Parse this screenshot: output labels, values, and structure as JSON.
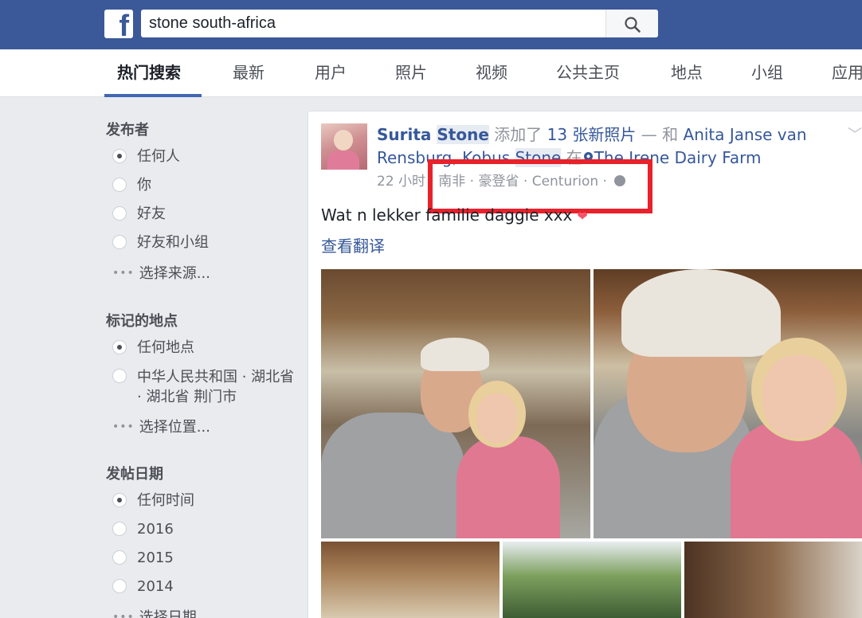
{
  "topbar": {
    "logo": "f",
    "search_value": "stone south-africa",
    "search_icon": "search-icon"
  },
  "tabs": [
    {
      "label": "热门搜索",
      "active": true
    },
    {
      "label": "最新"
    },
    {
      "label": "用户"
    },
    {
      "label": "照片"
    },
    {
      "label": "视频"
    },
    {
      "label": "公共主页"
    },
    {
      "label": "地点"
    },
    {
      "label": "小组"
    },
    {
      "label": "应用"
    }
  ],
  "sidebar": {
    "publisher": {
      "heading": "发布者",
      "options": [
        "任何人",
        "你",
        "好友",
        "好友和小组"
      ],
      "selected": 0,
      "more": "选择来源..."
    },
    "tagged_location": {
      "heading": "标记的地点",
      "options": [
        "任何地点",
        "中华人民共和国 · 湖北省 · 湖北省 荆门市"
      ],
      "selected": 0,
      "more": "选择位置..."
    },
    "post_date": {
      "heading": "发帖日期",
      "options": [
        "任何时间",
        "2016",
        "2015",
        "2014"
      ],
      "selected": 0,
      "more": "选择日期"
    }
  },
  "post": {
    "author_first": "Surita",
    "author_last": "Stone",
    "action": "添加了",
    "photo_count_text": "13 张新照片",
    "with_text": "— 和",
    "tagged_1": "Anita Janse van Rensburg",
    "tagged_1_line1": "Anita Janse van",
    "tagged_1_line2": "Rensburg",
    "tagged_2_first": "Kobus",
    "tagged_2_last": "Stone",
    "at_text": "在",
    "place": "The Irene Dairy Farm",
    "time": "22 小时",
    "location_country": "南非",
    "location_province": "豪登省",
    "location_city": "Centurion",
    "text": "Wat n lekker familie daggie xxx",
    "translate": "查看翻译",
    "photo_count": 13
  },
  "colors": {
    "brand": "#3b5998",
    "link": "#365899",
    "highlight_box": "#e8212b"
  }
}
